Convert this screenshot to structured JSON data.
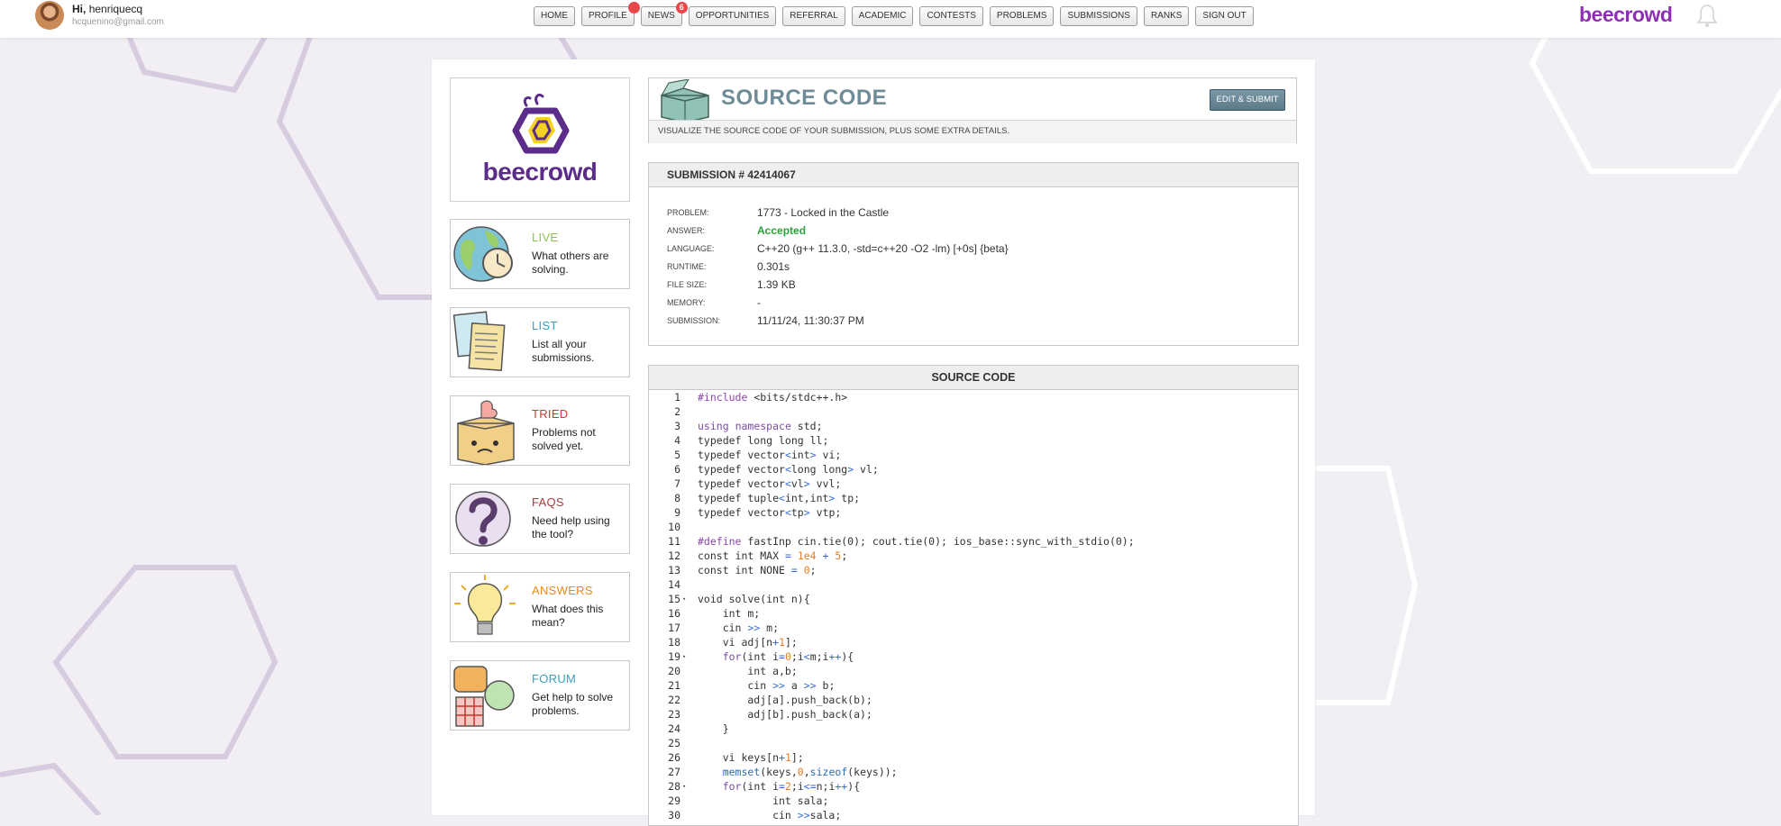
{
  "user": {
    "greeting": "Hi,",
    "name": "henriquecq",
    "email": "hcquenino@gmail.com"
  },
  "nav": [
    {
      "label": "HOME"
    },
    {
      "label": "PROFILE",
      "badge": ""
    },
    {
      "label": "NEWS",
      "badge": "6"
    },
    {
      "label": "OPPORTUNITIES"
    },
    {
      "label": "REFERRAL"
    },
    {
      "label": "ACADEMIC"
    },
    {
      "label": "CONTESTS"
    },
    {
      "label": "PROBLEMS"
    },
    {
      "label": "SUBMISSIONS"
    },
    {
      "label": "RANKS"
    },
    {
      "label": "SIGN OUT"
    }
  ],
  "brand": {
    "name": "beecrowd",
    "color": "#8e2fb5",
    "icon": "bell-icon"
  },
  "sidebar": {
    "logo_text": "beecrowd",
    "items": [
      {
        "title": "LIVE",
        "desc": "What others are solving.",
        "color": "#8bc34a",
        "icon": "globe-clock-icon"
      },
      {
        "title": "LIST",
        "desc": "List all your submissions.",
        "color": "#3a9fbf",
        "icon": "papers-icon"
      },
      {
        "title": "TRIED",
        "desc": "Problems not solved yet.",
        "color": "#d9342b",
        "icon": "box-icon"
      },
      {
        "title": "FAQS",
        "desc": "Need help using the tool?",
        "color": "#a83c3c",
        "icon": "question-icon"
      },
      {
        "title": "ANSWERS",
        "desc": "What does this mean?",
        "color": "#e8891d",
        "icon": "lightbulb-icon"
      },
      {
        "title": "FORUM",
        "desc": "Get help to solve problems.",
        "color": "#3a9fbf",
        "icon": "chat-icon"
      }
    ]
  },
  "header": {
    "title": "SOURCE CODE",
    "edit_button": "EDIT & SUBMIT",
    "subtitle": "VISUALIZE THE SOURCE CODE OF YOUR SUBMISSION, PLUS SOME EXTRA DETAILS."
  },
  "submission": {
    "heading": "SUBMISSION # 42414067",
    "details": [
      {
        "label": "PROBLEM:",
        "value": "1773 - Locked in the Castle"
      },
      {
        "label": "ANSWER:",
        "value": "Accepted"
      },
      {
        "label": "LANGUAGE:",
        "value": "C++20 (g++ 11.3.0, -std=c++20 -O2 -lm) [+0s] {beta}"
      },
      {
        "label": "RUNTIME:",
        "value": "0.301s"
      },
      {
        "label": "FILE SIZE:",
        "value": "1.39 KB"
      },
      {
        "label": "MEMORY:",
        "value": "-"
      },
      {
        "label": "SUBMISSION:",
        "value": "11/11/24, 11:30:37 PM"
      }
    ]
  },
  "source": {
    "heading": "SOURCE CODE",
    "lines": [
      {
        "n": "1",
        "text": "#include <bits/stdc++.h>"
      },
      {
        "n": "2",
        "text": ""
      },
      {
        "n": "3",
        "text": "using namespace std;"
      },
      {
        "n": "4",
        "text": "typedef long long ll;"
      },
      {
        "n": "5",
        "text": "typedef vector<int> vi;"
      },
      {
        "n": "6",
        "text": "typedef vector<long long> vl;"
      },
      {
        "n": "7",
        "text": "typedef vector<vl> vvl;"
      },
      {
        "n": "8",
        "text": "typedef tuple<int,int> tp;"
      },
      {
        "n": "9",
        "text": "typedef vector<tp> vtp;"
      },
      {
        "n": "10",
        "text": ""
      },
      {
        "n": "11",
        "text": "#define fastInp cin.tie(0); cout.tie(0); ios_base::sync_with_stdio(0);"
      },
      {
        "n": "12",
        "text": "const int MAX = 1e4 + 5;"
      },
      {
        "n": "13",
        "text": "const int NONE = 0;"
      },
      {
        "n": "14",
        "text": ""
      },
      {
        "n": "15",
        "text": "void solve(int n){",
        "fold": true
      },
      {
        "n": "16",
        "text": "    int m;"
      },
      {
        "n": "17",
        "text": "    cin >> m;"
      },
      {
        "n": "18",
        "text": "    vi adj[n+1];"
      },
      {
        "n": "19",
        "text": "    for(int i=0;i<m;i++){",
        "fold": true
      },
      {
        "n": "20",
        "text": "        int a,b;"
      },
      {
        "n": "21",
        "text": "        cin >> a >> b;"
      },
      {
        "n": "22",
        "text": "        adj[a].push_back(b);"
      },
      {
        "n": "23",
        "text": "        adj[b].push_back(a);"
      },
      {
        "n": "24",
        "text": "    }"
      },
      {
        "n": "25",
        "text": ""
      },
      {
        "n": "26",
        "text": "    vi keys[n+1];"
      },
      {
        "n": "27",
        "text": "    memset(keys,0,sizeof(keys));"
      },
      {
        "n": "28",
        "text": "    for(int i=2;i<=n;i++){",
        "fold": true
      },
      {
        "n": "29",
        "text": "            int sala;"
      },
      {
        "n": "30",
        "text": "            cin >>sala;"
      }
    ]
  }
}
